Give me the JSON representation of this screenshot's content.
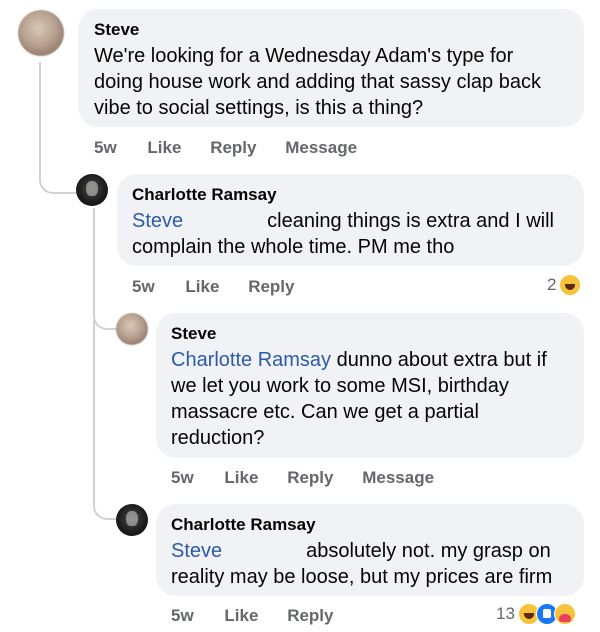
{
  "comments": [
    {
      "author": "Steve",
      "text": "We're looking for a Wednesday Adam's type for doing house work and adding that sassy clap back vibe to social settings, is this a thing?",
      "lines": [
        "We're looking for a Wednesday Adam's type for",
        "doing house work and adding that sassy clap back",
        "vibe to social settings, is this a thing?"
      ],
      "time": "5w",
      "actions": [
        "Like",
        "Reply",
        "Message"
      ]
    },
    {
      "author": "Charlotte Ramsay",
      "mention": "Steve",
      "line1": "cleaning things is extra and I will",
      "line2": "complain the whole time. PM me tho",
      "time": "5w",
      "actions": [
        "Like",
        "Reply"
      ],
      "reaction_count": "2",
      "reactions": [
        "haha-icon"
      ]
    },
    {
      "author": "Steve",
      "mention": "Charlotte Ramsay",
      "line1": "dunno about extra but if",
      "line2": "we let you work to some MSI, birthday",
      "line3": "massacre etc. Can we get a partial",
      "line4": "reduction?",
      "time": "5w",
      "actions": [
        "Like",
        "Reply",
        "Message"
      ]
    },
    {
      "author": "Charlotte Ramsay",
      "mention": "Steve",
      "line1": "absolutely not. my grasp on",
      "line2": "reality may be loose, but my prices are firm",
      "time": "5w",
      "actions": [
        "Like",
        "Reply"
      ],
      "reaction_count": "13",
      "reactions": [
        "haha-icon",
        "like-icon",
        "care-icon"
      ]
    }
  ],
  "colors": {
    "bubble": "#f0f2f5",
    "mention": "#2d5aa8",
    "meta": "#65676b",
    "thread_line": "#cfd2d6"
  }
}
